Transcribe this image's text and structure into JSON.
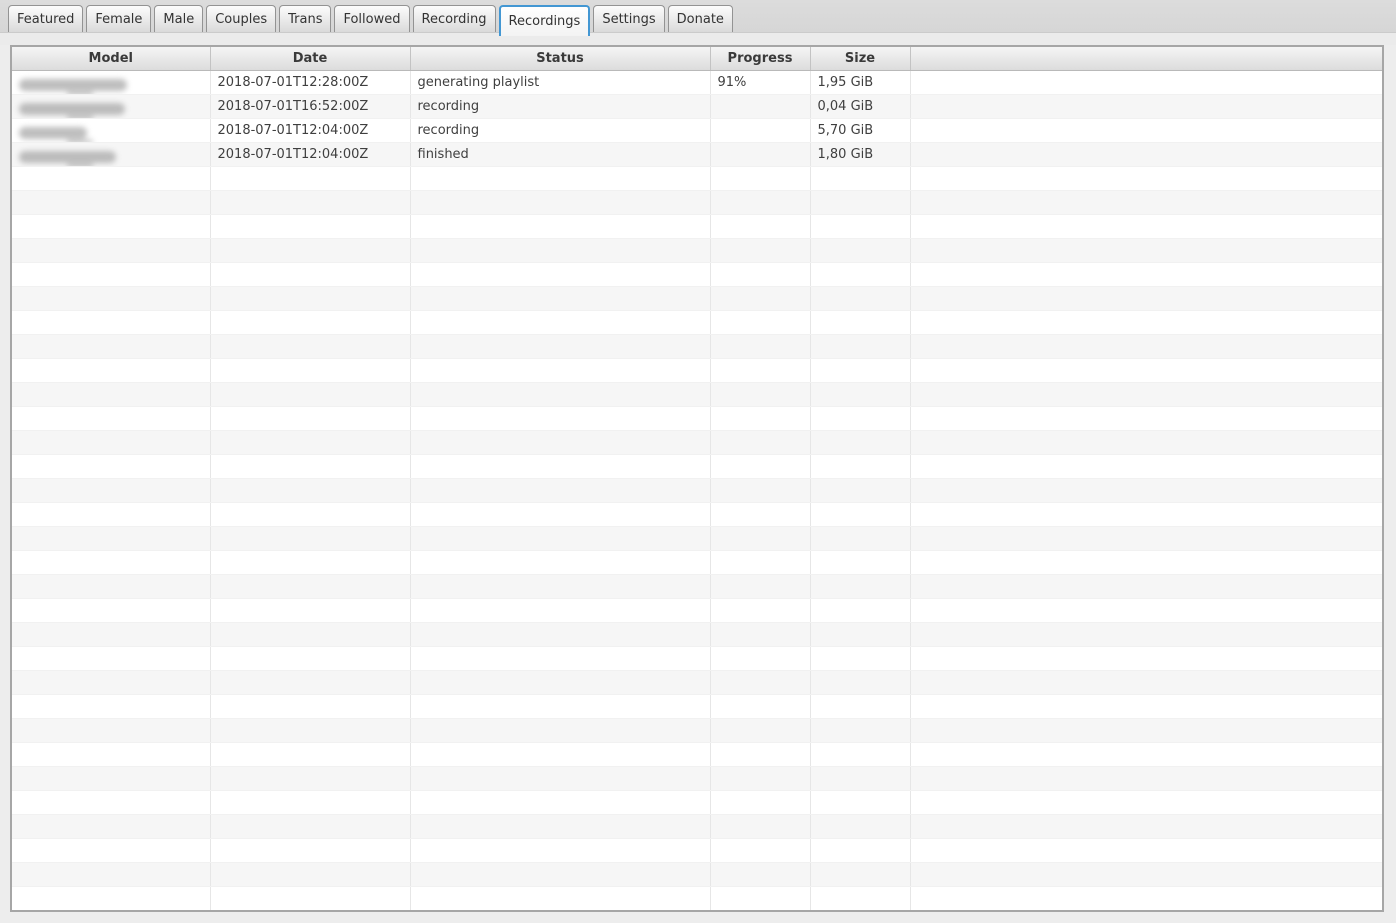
{
  "tabs": {
    "items": [
      {
        "label": "Featured",
        "selected": false
      },
      {
        "label": "Female",
        "selected": false
      },
      {
        "label": "Male",
        "selected": false
      },
      {
        "label": "Couples",
        "selected": false
      },
      {
        "label": "Trans",
        "selected": false
      },
      {
        "label": "Followed",
        "selected": false
      },
      {
        "label": "Recording",
        "selected": false
      },
      {
        "label": "Recordings",
        "selected": true
      },
      {
        "label": "Settings",
        "selected": false
      },
      {
        "label": "Donate",
        "selected": false
      }
    ]
  },
  "table": {
    "columns": [
      {
        "label": "Model"
      },
      {
        "label": "Date"
      },
      {
        "label": "Status"
      },
      {
        "label": "Progress"
      },
      {
        "label": "Size"
      },
      {
        "label": ""
      }
    ],
    "rows": [
      {
        "model": "",
        "model_redacted": true,
        "redacted_width": 108,
        "date": "2018-07-01T12:28:00Z",
        "status": "generating playlist",
        "progress": "91%",
        "size": "1,95 GiB"
      },
      {
        "model": "",
        "model_redacted": true,
        "redacted_width": 106,
        "date": "2018-07-01T16:52:00Z",
        "status": "recording",
        "progress": "",
        "size": "0,04 GiB"
      },
      {
        "model": "",
        "model_redacted": true,
        "redacted_width": 68,
        "date": "2018-07-01T12:04:00Z",
        "status": "recording",
        "progress": "",
        "size": "5,70 GiB"
      },
      {
        "model": "",
        "model_redacted": true,
        "redacted_width": 97,
        "date": "2018-07-01T12:04:00Z",
        "status": "finished",
        "progress": "",
        "size": "1,80 GiB"
      }
    ],
    "empty_rows": 31
  },
  "colors": {
    "selected_tab_border": "#4397d3",
    "row_alt_background": "#f6f6f6",
    "table_border": "#a6a6a6"
  }
}
